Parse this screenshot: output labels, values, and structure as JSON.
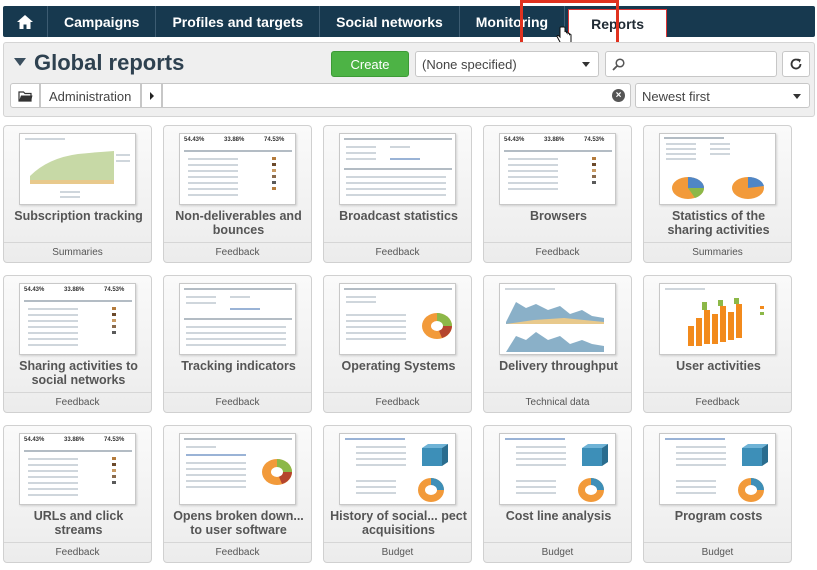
{
  "nav": {
    "items": [
      "Campaigns",
      "Profiles and targets",
      "Social networks",
      "Monitoring",
      "Reports"
    ],
    "active": "Reports"
  },
  "header": {
    "title": "Global reports",
    "create_label": "Create",
    "filter_value": "(None specified)",
    "search_value": "",
    "breadcrumb": "Administration",
    "sort_value": "Newest first"
  },
  "icons": {
    "home": "home-icon",
    "search": "search-icon",
    "refresh": "refresh-icon",
    "folder": "folder-icon",
    "clear": "clear-icon"
  },
  "reports": [
    {
      "title": "Subscription tracking",
      "category": "Summaries"
    },
    {
      "title": "Non-deliverables and bounces",
      "category": "Feedback"
    },
    {
      "title": "Broadcast statistics",
      "category": "Feedback"
    },
    {
      "title": "Browsers",
      "category": "Feedback"
    },
    {
      "title": "Statistics of the sharing activities",
      "category": "Summaries"
    },
    {
      "title": "Sharing activities to social networks",
      "category": "Feedback"
    },
    {
      "title": "Tracking indicators",
      "category": "Feedback"
    },
    {
      "title": "Operating Systems",
      "category": "Feedback"
    },
    {
      "title": "Delivery throughput",
      "category": "Technical data"
    },
    {
      "title": "User activities",
      "category": "Feedback"
    },
    {
      "title": "URLs and click streams",
      "category": "Feedback"
    },
    {
      "title": "Opens broken down... to user software",
      "category": "Feedback"
    },
    {
      "title": "History of social... pect acquisitions",
      "category": "Budget"
    },
    {
      "title": "Cost line analysis",
      "category": "Budget"
    },
    {
      "title": "Program costs",
      "category": "Budget"
    }
  ],
  "thumb_stats": [
    "54.43%",
    "33.88%",
    "74.53%"
  ],
  "colors": {
    "nav_bg": "#17394f",
    "highlight": "#e0321f",
    "create_bg": "#4db345",
    "title": "#2e4150"
  }
}
